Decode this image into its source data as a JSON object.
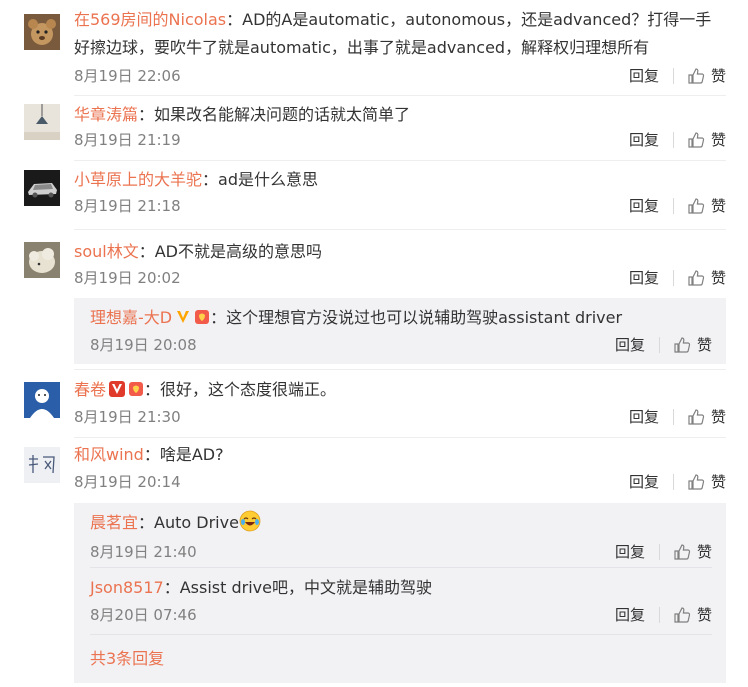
{
  "labels": {
    "reply": "回复",
    "like": "赞"
  },
  "colors": {
    "username": "#eb7350",
    "meta": "#808080",
    "text": "#333333",
    "sub_background": "#f2f2f5"
  },
  "comments": [
    {
      "user": "在569房间的Nicolas",
      "text": "AD的A是automatic，autonomous，还是advanced？打得一手好擦边球，要吹牛了就是automatic，出事了就是advanced，解释权归理想所有",
      "time": "8月19日 22:06",
      "avatar_icon": "teddy-bear-avatar"
    },
    {
      "user": "华章涛篇",
      "text": "如果改名能解决问题的话就太简单了",
      "time": "8月19日 21:19",
      "avatar_icon": "lamp-avatar"
    },
    {
      "user": "小草原上的大羊驼",
      "text": "ad是什么意思",
      "time": "8月19日 21:18",
      "avatar_icon": "car-model-avatar"
    },
    {
      "user": "soul林文",
      "text": "AD不就是高级的意思吗",
      "time": "8月19日 20:02",
      "avatar_icon": "sheep-avatar",
      "replies": [
        {
          "user": "理想嘉-大D",
          "text": "这个理想官方没说过也可以说辅助驾驶assistant driver",
          "time": "8月19日 20:08",
          "badges": [
            "verified-v-icon",
            "fan-badge-icon"
          ]
        }
      ]
    },
    {
      "user": "春卷",
      "text": "很好，这个态度很端正。",
      "time": "8月19日 21:30",
      "avatar_icon": "cartoon-person-avatar",
      "badges": [
        "verified-v-icon",
        "fan-badge-icon"
      ]
    },
    {
      "user": "和风wind",
      "text": "啥是AD?",
      "time": "8月19日 20:14",
      "avatar_icon": "calligraphy-avatar",
      "replies": [
        {
          "user": "晨茗宜",
          "text": "Auto Drive",
          "time": "8月19日 21:40",
          "emoji": "laughing-tears-emoji"
        },
        {
          "user": "Json8517",
          "text": "Assist drive吧，中文就是辅助驾驶",
          "time": "8月20日 07:46"
        }
      ],
      "more_replies": "共3条回复"
    }
  ]
}
